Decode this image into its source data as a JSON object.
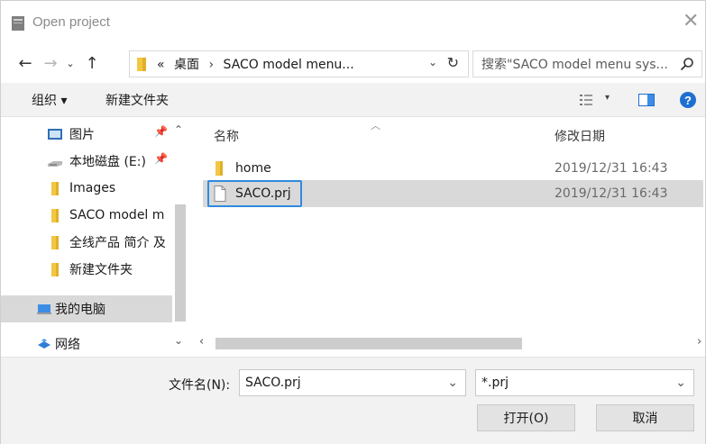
{
  "window": {
    "title": "Open project"
  },
  "nav": {
    "breadcrumb": [
      "«",
      "桌面",
      "SACO model menu..."
    ],
    "search_placeholder": "搜索\"SACO model menu sys..."
  },
  "toolbar": {
    "organize": "组织 ▾",
    "new_folder": "新建文件夹"
  },
  "sidebar": {
    "items": [
      {
        "label": "图片",
        "icon": "pictures-icon"
      },
      {
        "label": "本地磁盘 (E:)",
        "icon": "drive-icon"
      },
      {
        "label": "Images",
        "icon": "folder-icon"
      },
      {
        "label": "SACO model m",
        "icon": "folder-icon"
      },
      {
        "label": "全线产品 简介 及",
        "icon": "folder-icon"
      },
      {
        "label": "新建文件夹",
        "icon": "folder-icon"
      },
      {
        "label": "我的电脑",
        "icon": "computer-icon"
      },
      {
        "label": "网络",
        "icon": "network-icon"
      }
    ]
  },
  "filelist": {
    "columns": {
      "name": "名称",
      "modified": "修改日期"
    },
    "rows": [
      {
        "name": "home",
        "type": "folder",
        "modified": "2019/12/31 16:43"
      },
      {
        "name": "SACO.prj",
        "type": "file",
        "modified": "2019/12/31 16:43"
      }
    ]
  },
  "bottom": {
    "filename_label": "文件名(N):",
    "filename_value": "SACO.prj",
    "filetype_value": "*.prj",
    "open_label": "打开(O)",
    "cancel_label": "取消"
  },
  "colors": {
    "folder": "#f2c744",
    "focus": "#2f8ae0",
    "selected_bg": "#d9d9d9",
    "help": "#1f6fd1"
  }
}
